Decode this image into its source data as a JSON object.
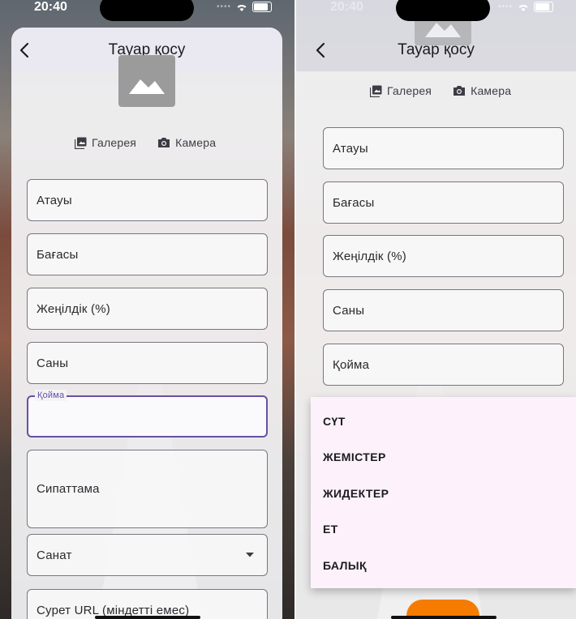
{
  "status": {
    "time": "20:40"
  },
  "left": {
    "title": "Тауар қосу",
    "gallery_label": "Галерея",
    "camera_label": "Камера",
    "fields": {
      "name": "Атауы",
      "price": "Бағасы",
      "discount": "Жеңілдік (%)",
      "quantity": "Саны",
      "warehouse": "Қойма",
      "description": "Сипаттама",
      "category": "Санат",
      "image_url": "Сурет URL (міндетті емес)"
    }
  },
  "right": {
    "title": "Тауар қосу",
    "gallery_label": "Галерея",
    "camera_label": "Камера",
    "fields": {
      "name": "Атауы",
      "price": "Бағасы",
      "discount": "Жеңілдік (%)",
      "quantity": "Саны",
      "warehouse": "Қойма"
    },
    "menu_items": [
      "СҮТ",
      "ЖЕМІСТЕР",
      "ЖИДЕКТЕР",
      "ЕТ",
      "БАЛЫҚ"
    ]
  },
  "colors": {
    "accent": "#6750a4",
    "menu_bg": "#fdf2fb",
    "button": "#f57c00"
  }
}
